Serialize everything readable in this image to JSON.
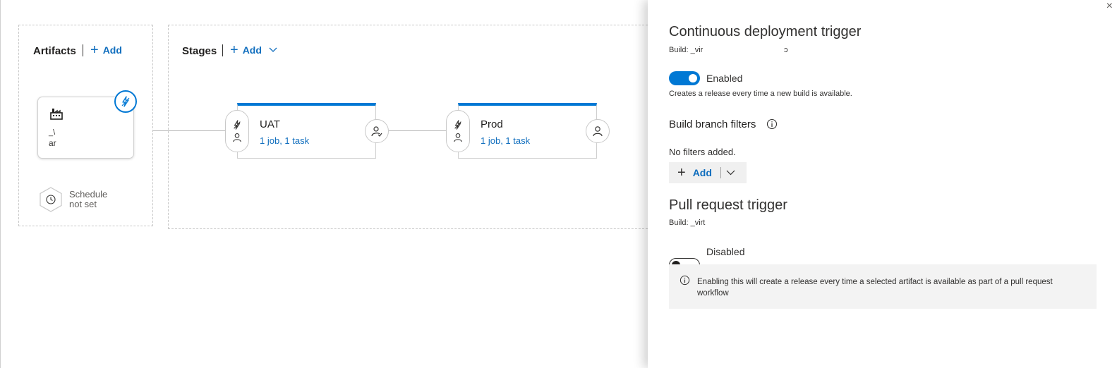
{
  "artifacts": {
    "title": "Artifacts",
    "add_label": "Add",
    "card": {
      "icon": "factory-build-icon",
      "line1": "_\\",
      "line2": "ar"
    },
    "schedule": {
      "line1": "Schedule",
      "line2": "not set"
    }
  },
  "stages": {
    "title": "Stages",
    "add_label": "Add",
    "items": [
      {
        "name": "UAT",
        "summary": "1 job, 1 task"
      },
      {
        "name": "Prod",
        "summary": "1 job, 1 task"
      }
    ]
  },
  "panel": {
    "close_glyph": "×",
    "cd_trigger": {
      "title": "Continuous deployment trigger",
      "build": "Build: _vir",
      "build_tail": "ɔ",
      "toggle_label": "Enabled",
      "enabled": true,
      "description": "Creates a release every time a new build is available."
    },
    "branch_filters": {
      "title": "Build branch filters",
      "empty_text": "No filters added.",
      "add_label": "Add"
    },
    "pr_trigger": {
      "title": "Pull request trigger",
      "build": "Build: _virt",
      "toggle_label": "Disabled",
      "enabled": false,
      "info_line1": "Enabling this will create a release every time a selected artifact is available as part of a pull request",
      "info_line2": "workflow"
    }
  },
  "colors": {
    "accent": "#0078d4",
    "link": "#106ebe"
  }
}
